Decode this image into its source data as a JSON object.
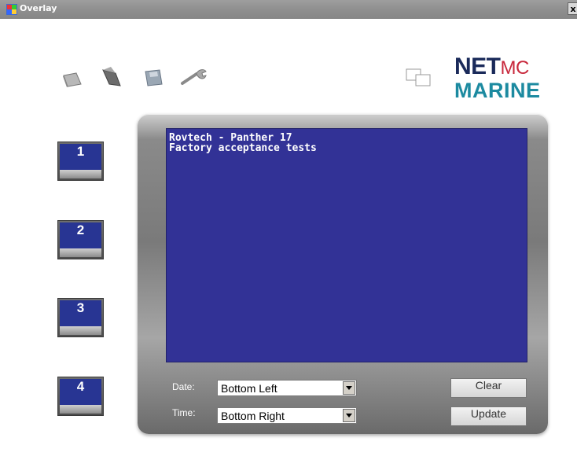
{
  "window": {
    "title": "Overlay",
    "close_label": "x"
  },
  "toolbar": {
    "icons": [
      "card-icon",
      "open-file-icon",
      "save-disk-icon",
      "wrench-icon"
    ]
  },
  "header_icon": "windows-overlay-icon",
  "logo": {
    "line1_main": "NET",
    "line1_small": "MC",
    "line2": "MARINE"
  },
  "channels": [
    "1",
    "2",
    "3",
    "4"
  ],
  "screen": {
    "line1": "Rovtech - Panther 17",
    "line2": "Factory acceptance tests"
  },
  "controls": {
    "date_label": "Date:",
    "date_value": "Bottom Left",
    "time_label": "Time:",
    "time_value": "Bottom Right",
    "clear_label": "Clear",
    "update_label": "Update"
  },
  "colors": {
    "screen_bg": "#323296",
    "channel_face": "#283593",
    "titlebar": "#8f8f8f"
  }
}
